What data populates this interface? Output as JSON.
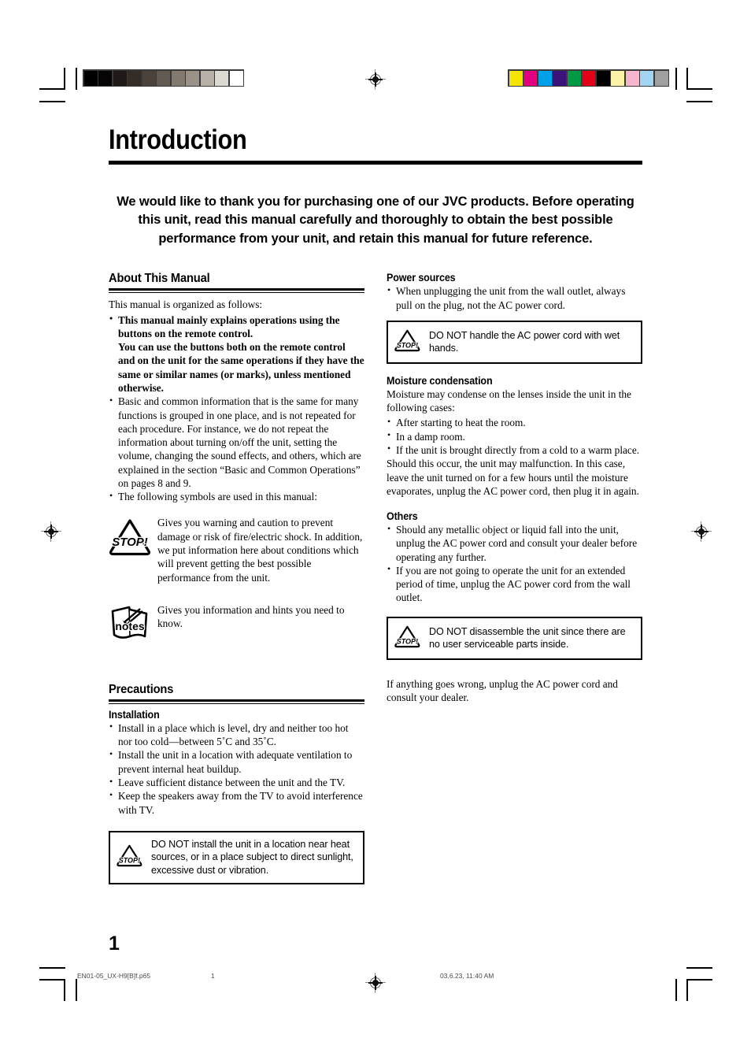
{
  "document": {
    "title": "Introduction",
    "lead_paragraph": "We would like to thank you for purchasing one of our JVC products. Before operating this unit, read this manual carefully and thoroughly to obtain the best possible performance from your unit, and retain this manual for future reference.",
    "page_number": "1"
  },
  "left_column": {
    "about": {
      "heading": "About This Manual",
      "intro": "This manual is organized as follows:",
      "bullets": [
        "This manual mainly explains operations using the buttons on the remote control.",
        "You can use the buttons both on the remote control and on the unit for the same operations if they have the same or similar names (or marks), unless mentioned otherwise.",
        "Basic and common information that is the same for many functions is grouped in one place, and is not repeated for each procedure. For instance, we do not repeat the information about turning on/off the unit, setting the volume, changing the sound effects, and others, which are explained in the section “Basic and Common Operations” on pages 8 and 9.",
        "The following symbols are used in this manual:"
      ]
    },
    "symbol_legend": [
      {
        "icon": "stop-warning-icon",
        "icon_label": "STOP!",
        "text": "Gives you warning and caution to prevent damage or risk of fire/electric shock. In addition, we put information here about conditions which will prevent getting the best possible performance from the unit."
      },
      {
        "icon": "notes-icon",
        "icon_label": "notes",
        "text": "Gives you information and hints you need to know."
      }
    ],
    "precautions": {
      "heading": "Precautions",
      "installation": {
        "subheading": "Installation",
        "bullets": [
          "Install in a place which is level, dry and neither too hot nor too cold—between 5˚C and 35˚C.",
          "Install the unit in a location with adequate ventilation to prevent internal heat buildup.",
          "Leave sufficient distance between the unit and the TV.",
          "Keep the speakers away from the TV to avoid interference with TV."
        ]
      },
      "caution_box": {
        "icon": "stop-warning-icon",
        "text": "DO NOT install the unit in a location near heat sources, or in a place subject to direct sunlight, excessive dust or vibration."
      }
    }
  },
  "right_column": {
    "power_sources": {
      "subheading": "Power sources",
      "bullets": [
        "When unplugging the unit from the wall outlet, always pull on the plug, not the AC power cord."
      ],
      "caution_box": {
        "icon": "stop-warning-icon",
        "text": "DO NOT handle the AC power cord with wet hands."
      }
    },
    "moisture_condensation": {
      "subheading": "Moisture condensation",
      "intro": "Moisture may condense on the lenses inside the unit in the following cases:",
      "bullets": [
        "After starting to heat the room.",
        "In a damp room.",
        "If the unit is brought directly from a cold to a warm place."
      ],
      "outro": "Should this occur, the unit may malfunction. In this case, leave the unit turned on for a few hours until the moisture evaporates, unplug the AC power cord, then plug it in again."
    },
    "others": {
      "subheading": "Others",
      "bullets": [
        "Should any metallic object or liquid fall into the unit, unplug the AC power cord and consult your dealer before operating any further.",
        "If you are not going to operate the unit for an extended period of time, unplug the AC power cord from the wall outlet."
      ],
      "caution_box": {
        "icon": "stop-warning-icon",
        "text": "DO NOT disassemble the unit since there are no user serviceable parts inside."
      },
      "closing": "If anything goes wrong, unplug the AC power cord and consult your dealer."
    }
  },
  "print_marks": {
    "grayscale_patches": [
      "#000000",
      "#070406",
      "#1f1a17",
      "#332c27",
      "#4a423b",
      "#635b52",
      "#82796f",
      "#9a9188",
      "#b8b1a8",
      "#dcd9d2",
      "#ffffff"
    ],
    "color_patches": [
      "#f4e400",
      "#e3007f",
      "#00a0e9",
      "#3a1279",
      "#009944",
      "#e50019",
      "#000000",
      "#faf3a8",
      "#f5b5cd",
      "#a2d5f2",
      "#a0a0a0"
    ],
    "registration_mark": "registration-target-icon"
  },
  "footer": {
    "filename": "EN01-05_UX-H9[B]f.p65",
    "page_label": "1",
    "timestamp": "03.6.23, 11:40 AM"
  }
}
